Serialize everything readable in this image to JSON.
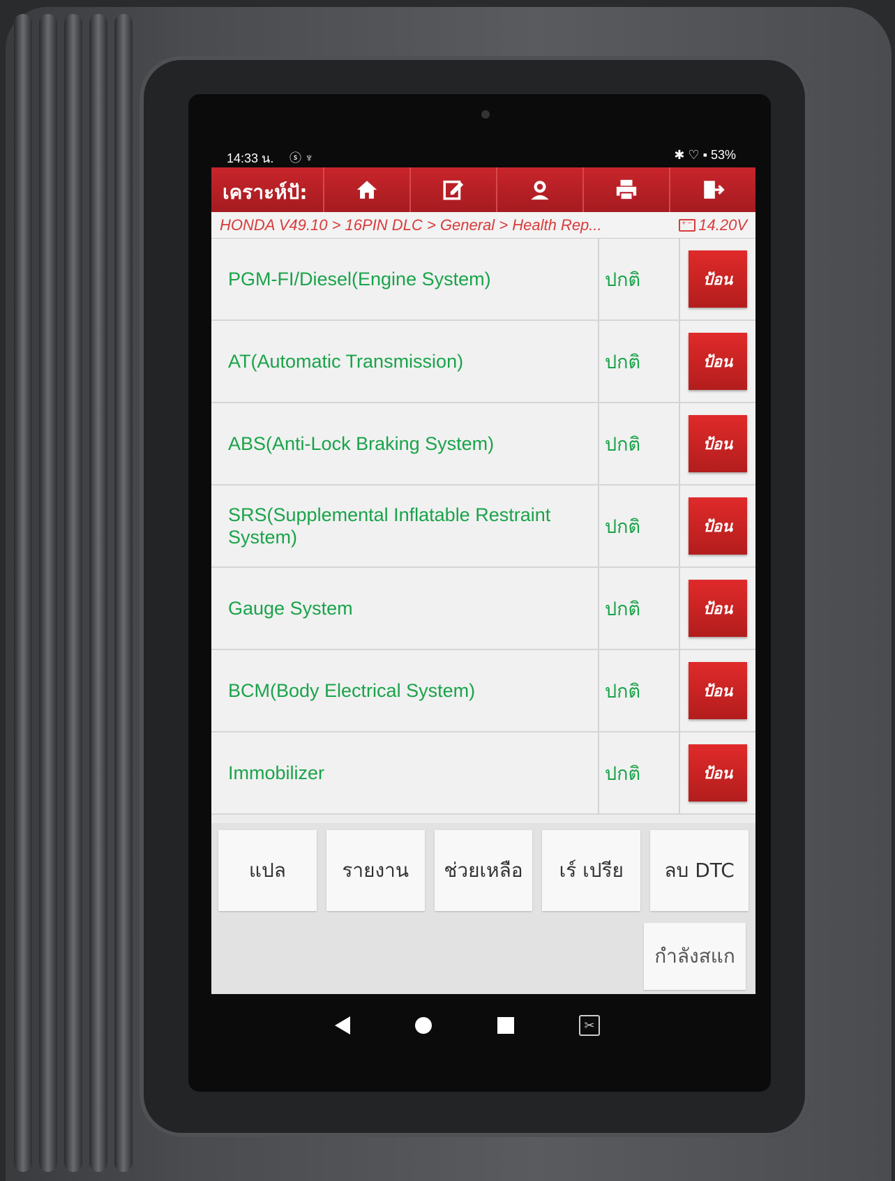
{
  "status_bar": {
    "time": "14:33 น.",
    "left_icons": "ⓢ ♆",
    "battery": "53%",
    "right_icons": "✱ ♡ ▪"
  },
  "header": {
    "title": "เคราะห์ปั:",
    "buttons": [
      {
        "name": "home-icon"
      },
      {
        "name": "edit-icon"
      },
      {
        "name": "support-icon"
      },
      {
        "name": "print-icon"
      },
      {
        "name": "exit-icon"
      }
    ],
    "accent_color": "#c8252b"
  },
  "breadcrumb": "HONDA V49.10 > 16PIN DLC > General > Health Rep...",
  "voltage": "14.20V",
  "systems": [
    {
      "name": "PGM-FI/Diesel(Engine System)",
      "status": "ปกติ",
      "action": "ป้อน"
    },
    {
      "name": "AT(Automatic Transmission)",
      "status": "ปกติ",
      "action": "ป้อน"
    },
    {
      "name": "ABS(Anti-Lock Braking System)",
      "status": "ปกติ",
      "action": "ป้อน"
    },
    {
      "name": "SRS(Supplemental Inflatable Restraint System)",
      "status": "ปกติ",
      "action": "ป้อน"
    },
    {
      "name": "Gauge System",
      "status": "ปกติ",
      "action": "ป้อน"
    },
    {
      "name": "BCM(Body Electrical System)",
      "status": "ปกติ",
      "action": "ป้อน"
    },
    {
      "name": "Immobilizer",
      "status": "ปกติ",
      "action": "ป้อน"
    }
  ],
  "bottom_buttons": {
    "translate": "แปล",
    "report": "รายงาน",
    "help": "ช่วยเหลือ",
    "compare": "เร์ เปรีย",
    "clear_dtc": "ลบ DTC",
    "scanning": "กำลังสแก"
  }
}
